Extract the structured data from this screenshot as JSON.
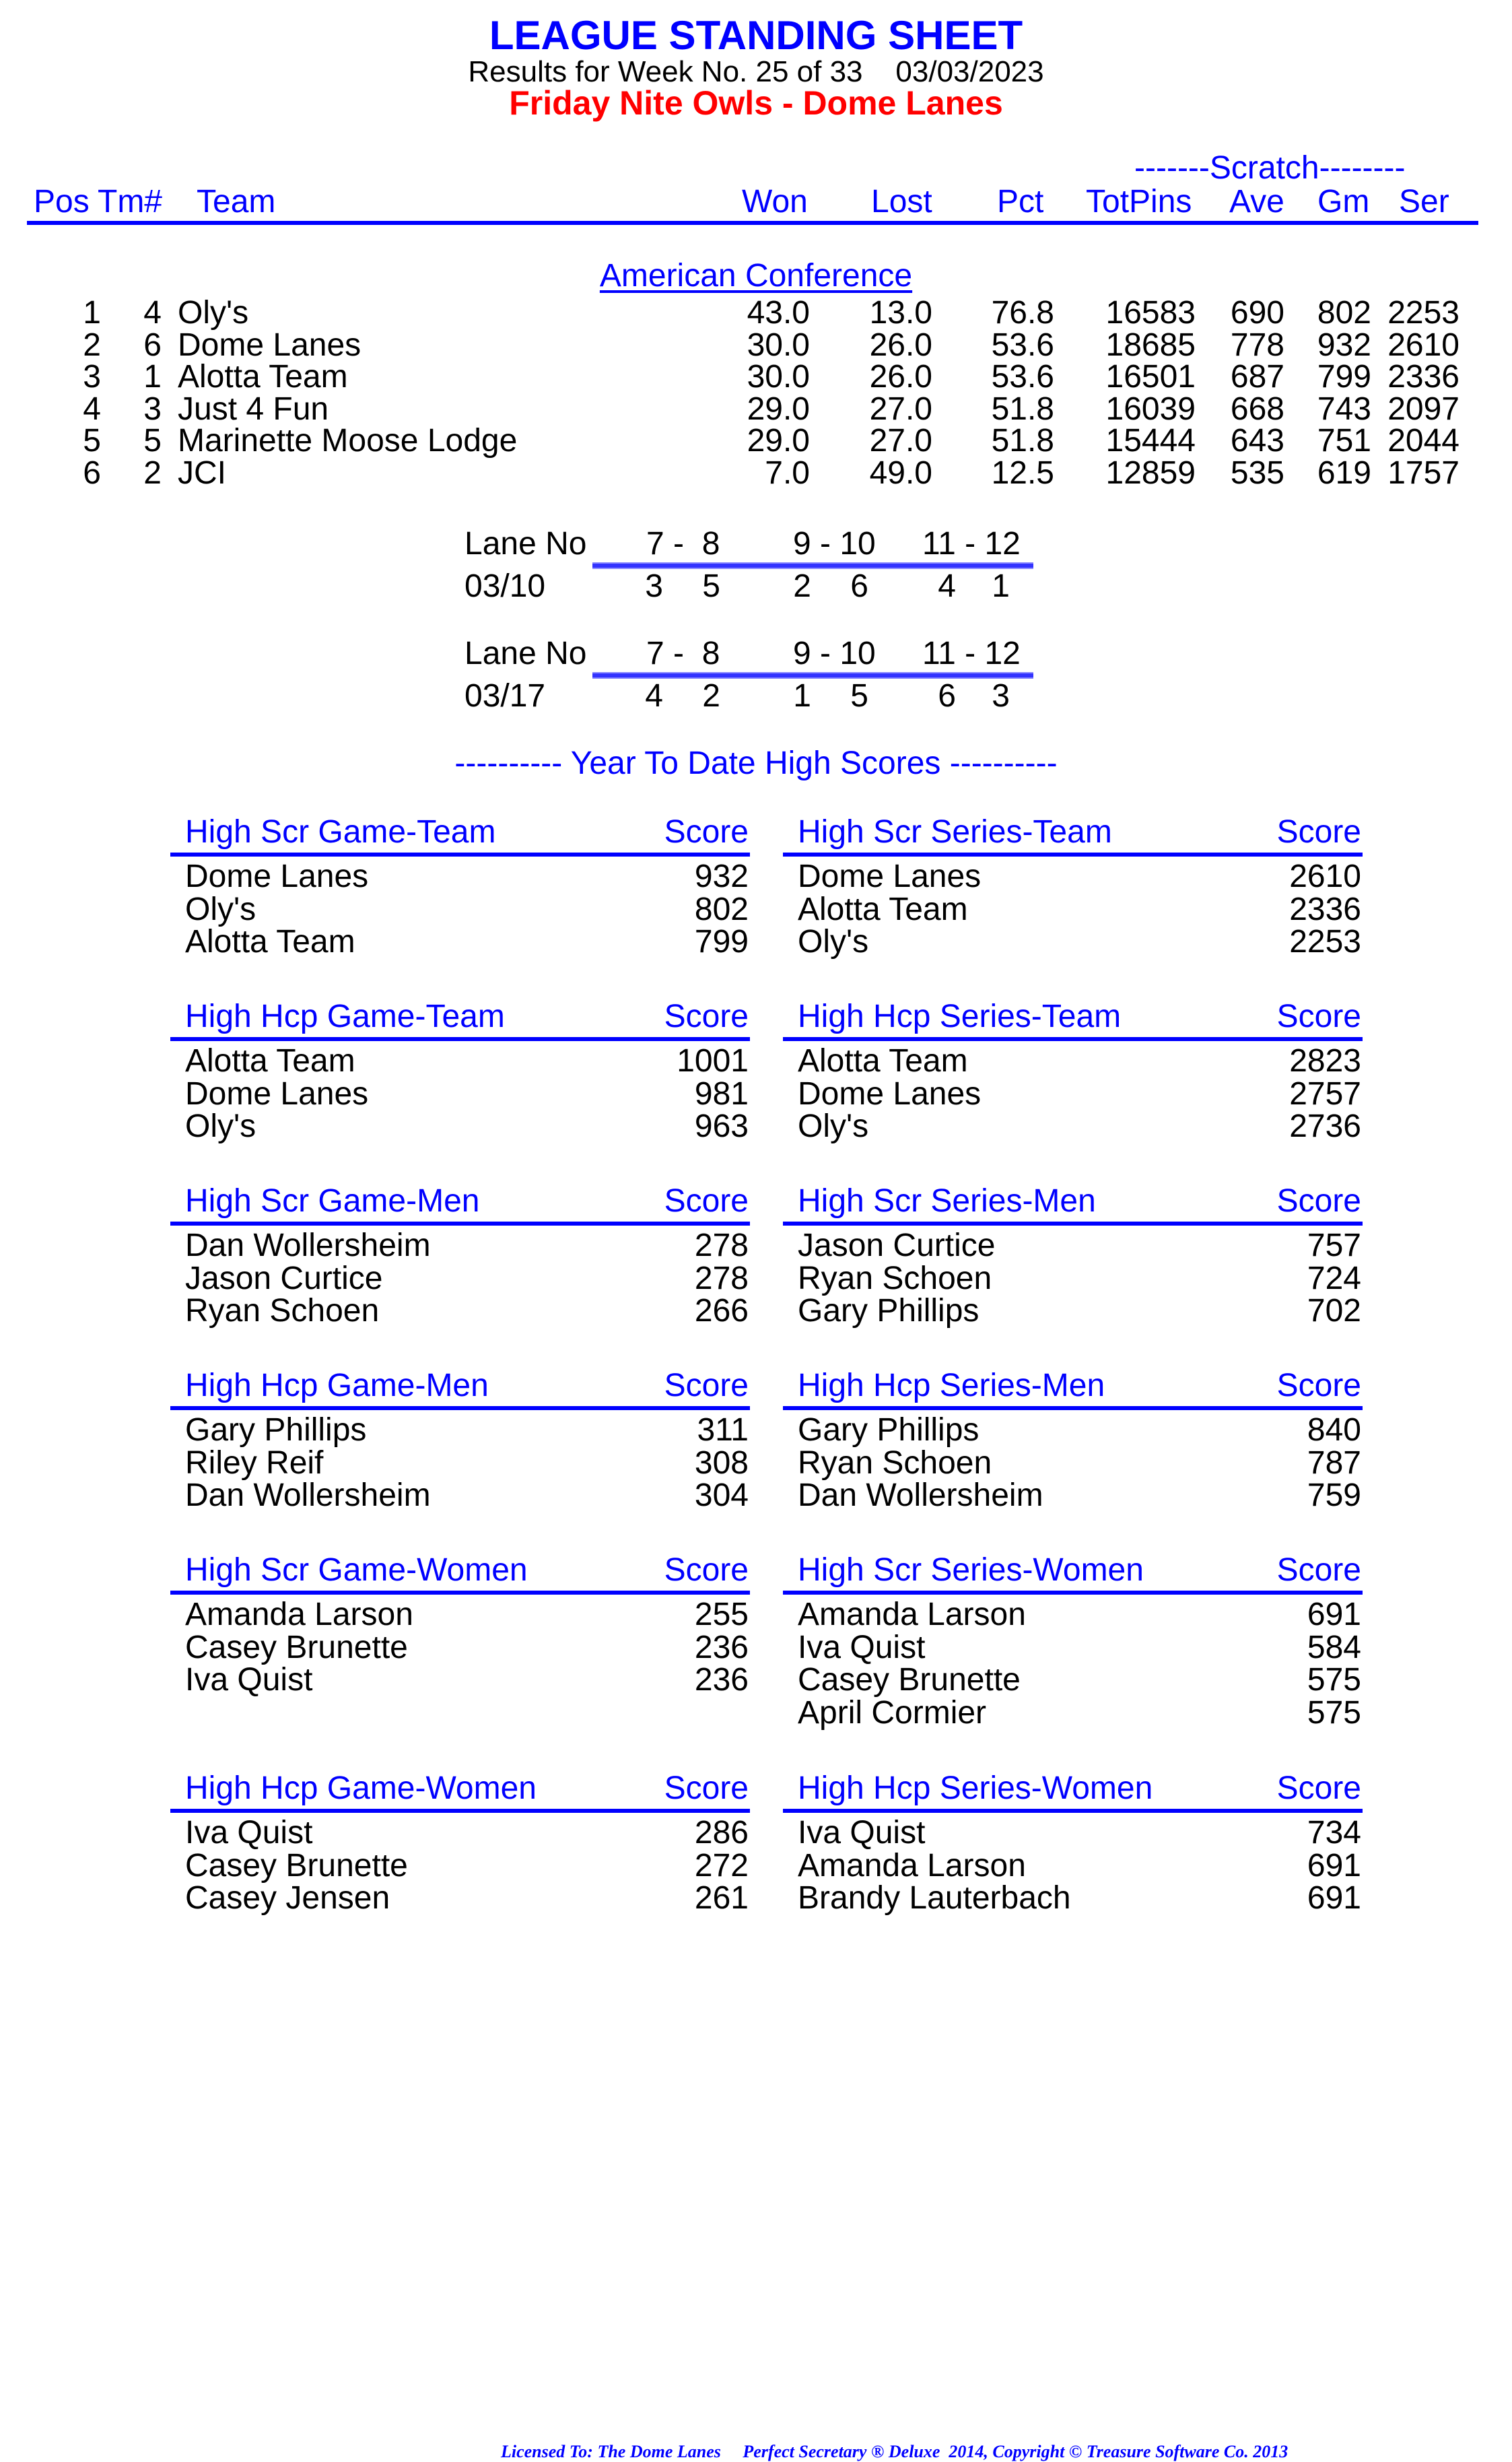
{
  "header": {
    "title": "LEAGUE STANDING SHEET",
    "subtitle": "Results for Week No. 25 of 33    03/03/2023",
    "league": "Friday Nite Owls - Dome Lanes"
  },
  "standings": {
    "scratch_label": "-------Scratch--------",
    "columns": [
      "Pos",
      "Tm#",
      "Team",
      "Won",
      "Lost",
      "Pct",
      "TotPins",
      "Ave",
      "Gm",
      "Ser"
    ],
    "conference": "American Conference",
    "rows": [
      {
        "pos": "1",
        "tm": "4",
        "team": "Oly's",
        "won": "43.0",
        "lost": "13.0",
        "pct": "76.8",
        "totpins": "16583",
        "ave": "690",
        "gm": "802",
        "ser": "2253"
      },
      {
        "pos": "2",
        "tm": "6",
        "team": "Dome Lanes",
        "won": "30.0",
        "lost": "26.0",
        "pct": "53.6",
        "totpins": "18685",
        "ave": "778",
        "gm": "932",
        "ser": "2610"
      },
      {
        "pos": "3",
        "tm": "1",
        "team": "Alotta Team",
        "won": "30.0",
        "lost": "26.0",
        "pct": "53.6",
        "totpins": "16501",
        "ave": "687",
        "gm": "799",
        "ser": "2336"
      },
      {
        "pos": "4",
        "tm": "3",
        "team": "Just 4 Fun",
        "won": "29.0",
        "lost": "27.0",
        "pct": "51.8",
        "totpins": "16039",
        "ave": "668",
        "gm": "743",
        "ser": "2097"
      },
      {
        "pos": "5",
        "tm": "5",
        "team": "Marinette Moose Lodge",
        "won": "29.0",
        "lost": "27.0",
        "pct": "51.8",
        "totpins": "15444",
        "ave": "643",
        "gm": "751",
        "ser": "2044"
      },
      {
        "pos": "6",
        "tm": "2",
        "team": "JCI",
        "won": "7.0",
        "lost": "49.0",
        "pct": "12.5",
        "totpins": "12859",
        "ave": "535",
        "gm": "619",
        "ser": "1757"
      }
    ]
  },
  "lanes": [
    {
      "label": "Lane No",
      "pairs": [
        "7 -  8",
        "9 - 10",
        "11 - 12"
      ],
      "date": "03/10",
      "teams": [
        "3",
        "5",
        "2",
        "6",
        "4",
        "1"
      ]
    },
    {
      "label": "Lane No",
      "pairs": [
        "7 -  8",
        "9 - 10",
        "11 - 12"
      ],
      "date": "03/17",
      "teams": [
        "4",
        "2",
        "1",
        "5",
        "6",
        "3"
      ]
    }
  ],
  "ytd_title": "---------- Year To Date High Scores ----------",
  "score_label": "Score",
  "high_scores": [
    {
      "title": "High Scr Game-Team",
      "items": [
        [
          "Dome Lanes",
          "932"
        ],
        [
          "Oly's",
          "802"
        ],
        [
          "Alotta Team",
          "799"
        ]
      ]
    },
    {
      "title": "High Scr Series-Team",
      "items": [
        [
          "Dome Lanes",
          "2610"
        ],
        [
          "Alotta Team",
          "2336"
        ],
        [
          "Oly's",
          "2253"
        ]
      ]
    },
    {
      "title": "High Hcp Game-Team",
      "items": [
        [
          "Alotta Team",
          "1001"
        ],
        [
          "Dome Lanes",
          "981"
        ],
        [
          "Oly's",
          "963"
        ]
      ]
    },
    {
      "title": "High Hcp Series-Team",
      "items": [
        [
          "Alotta Team",
          "2823"
        ],
        [
          "Dome Lanes",
          "2757"
        ],
        [
          "Oly's",
          "2736"
        ]
      ]
    },
    {
      "title": "High Scr Game-Men",
      "items": [
        [
          "Dan Wollersheim",
          "278"
        ],
        [
          "Jason Curtice",
          "278"
        ],
        [
          "Ryan Schoen",
          "266"
        ]
      ]
    },
    {
      "title": "High Scr Series-Men",
      "items": [
        [
          "Jason Curtice",
          "757"
        ],
        [
          "Ryan Schoen",
          "724"
        ],
        [
          "Gary Phillips",
          "702"
        ]
      ]
    },
    {
      "title": "High Hcp Game-Men",
      "items": [
        [
          "Gary Phillips",
          "311"
        ],
        [
          "Riley Reif",
          "308"
        ],
        [
          "Dan Wollersheim",
          "304"
        ]
      ]
    },
    {
      "title": "High Hcp Series-Men",
      "items": [
        [
          "Gary Phillips",
          "840"
        ],
        [
          "Ryan Schoen",
          "787"
        ],
        [
          "Dan Wollersheim",
          "759"
        ]
      ]
    },
    {
      "title": "High Scr Game-Women",
      "items": [
        [
          "Amanda Larson",
          "255"
        ],
        [
          "Casey Brunette",
          "236"
        ],
        [
          "Iva Quist",
          "236"
        ]
      ]
    },
    {
      "title": "High Scr Series-Women",
      "items": [
        [
          "Amanda Larson",
          "691"
        ],
        [
          "Iva Quist",
          "584"
        ],
        [
          "Casey Brunette",
          "575"
        ],
        [
          "April Cormier",
          "575"
        ]
      ]
    },
    {
      "title": "High Hcp Game-Women",
      "items": [
        [
          "Iva Quist",
          "286"
        ],
        [
          "Casey Brunette",
          "272"
        ],
        [
          "Casey Jensen",
          "261"
        ]
      ]
    },
    {
      "title": "High Hcp Series-Women",
      "items": [
        [
          "Iva Quist",
          "734"
        ],
        [
          "Amanda Larson",
          "691"
        ],
        [
          "Brandy Lauterbach",
          "691"
        ]
      ]
    }
  ],
  "footer": "Licensed To: The Dome Lanes     Perfect Secretary ® Deluxe  2014, Copyright © Treasure Software Co. 2013"
}
